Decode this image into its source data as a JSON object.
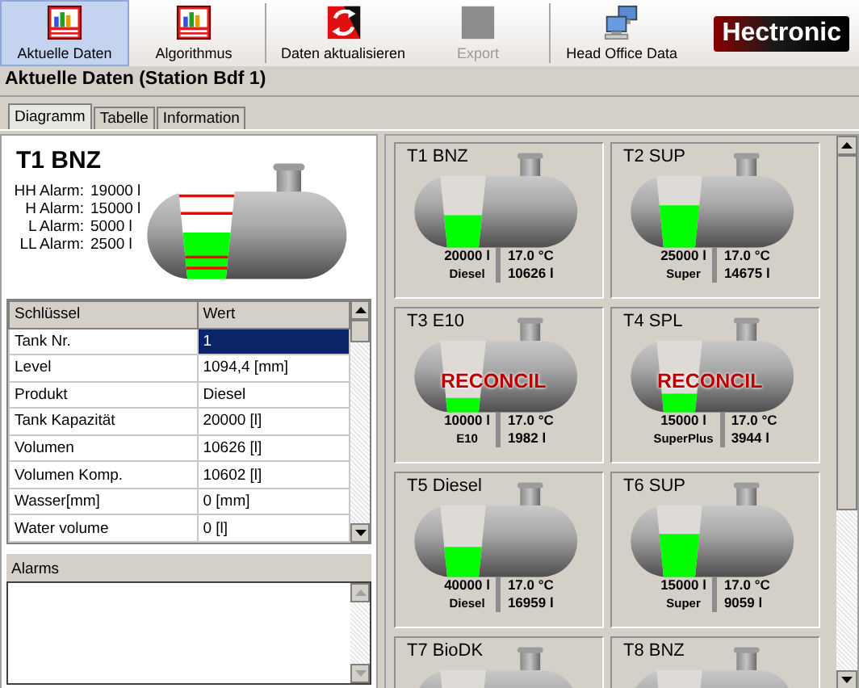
{
  "toolbar": {
    "buttons": [
      {
        "label": "Aktuelle Daten",
        "kind": "chart",
        "selected": true,
        "disabled": false,
        "separator_after": false
      },
      {
        "label": "Algorithmus",
        "kind": "chart",
        "selected": false,
        "disabled": false,
        "separator_after": true
      },
      {
        "label": "Daten aktualisieren",
        "kind": "refresh",
        "selected": false,
        "disabled": false,
        "separator_after": false
      },
      {
        "label": "Export",
        "kind": "export",
        "selected": false,
        "disabled": true,
        "separator_after": true
      },
      {
        "label": "Head Office Data",
        "kind": "computers",
        "selected": false,
        "disabled": false,
        "separator_after": false
      }
    ],
    "logo": "Hectronic"
  },
  "title": "Aktuelle Daten (Station Bdf 1)",
  "tabs": [
    {
      "label": "Diagramm",
      "selected": true
    },
    {
      "label": "Tabelle",
      "selected": false
    },
    {
      "label": "Information",
      "selected": false
    }
  ],
  "detail": {
    "name": "T1 BNZ",
    "level": 0.53,
    "alarms": [
      {
        "label": "HH Alarm:",
        "value": "19000 l",
        "level": 0.95
      },
      {
        "label": "H Alarm:",
        "value": "15000 l",
        "level": 0.75
      },
      {
        "label": "L Alarm:",
        "value": "5000 l",
        "level": 0.25
      },
      {
        "label": "LL Alarm:",
        "value": "2500 l",
        "level": 0.125
      }
    ],
    "grid": {
      "columns": [
        "Schlüssel",
        "Wert"
      ],
      "rows": [
        {
          "key": "Tank Nr.",
          "value": "1",
          "selected": true
        },
        {
          "key": "Level",
          "value": "1094,4 [mm]",
          "selected": false
        },
        {
          "key": "Produkt",
          "value": "Diesel",
          "selected": false
        },
        {
          "key": "Tank Kapazität",
          "value": "20000 [l]",
          "selected": false
        },
        {
          "key": "Volumen",
          "value": "10626 [l]",
          "selected": false
        },
        {
          "key": "Volumen Komp.",
          "value": "10602 [l]",
          "selected": false
        },
        {
          "key": "Wasser[mm]",
          "value": "0 [mm]",
          "selected": false
        },
        {
          "key": "Water volume",
          "value": "0 [l]",
          "selected": false
        }
      ]
    },
    "alarms_panel": {
      "title": "Alarms"
    }
  },
  "tanks": [
    {
      "name": "T1 BNZ",
      "level": 0.45,
      "capacity": "20000 l",
      "product": "Diesel",
      "temperature": "17.0 °C",
      "volume": "10626 l"
    },
    {
      "name": "T2 SUP",
      "level": 0.59,
      "capacity": "25000 l",
      "product": "Super",
      "temperature": "17.0 °C",
      "volume": "14675 l"
    },
    {
      "name": "T3 E10",
      "level": 0.2,
      "overlay": "RECONCIL",
      "capacity": "10000 l",
      "product": "E10",
      "temperature": "17.0 °C",
      "volume": "1982 l"
    },
    {
      "name": "T4 SPL",
      "level": 0.26,
      "overlay": "RECONCIL",
      "capacity": "15000 l",
      "product": "SuperPlus",
      "temperature": "17.0 °C",
      "volume": "3944 l"
    },
    {
      "name": "T5 Diesel",
      "level": 0.42,
      "capacity": "40000 l",
      "product": "Diesel",
      "temperature": "17.0 °C",
      "volume": "16959 l"
    },
    {
      "name": "T6 SUP",
      "level": 0.6,
      "capacity": "15000 l",
      "product": "Super",
      "temperature": "17.0 °C",
      "volume": "9059 l"
    },
    {
      "name": "T7 BioDK"
    },
    {
      "name": "T8 BNZ"
    }
  ]
}
